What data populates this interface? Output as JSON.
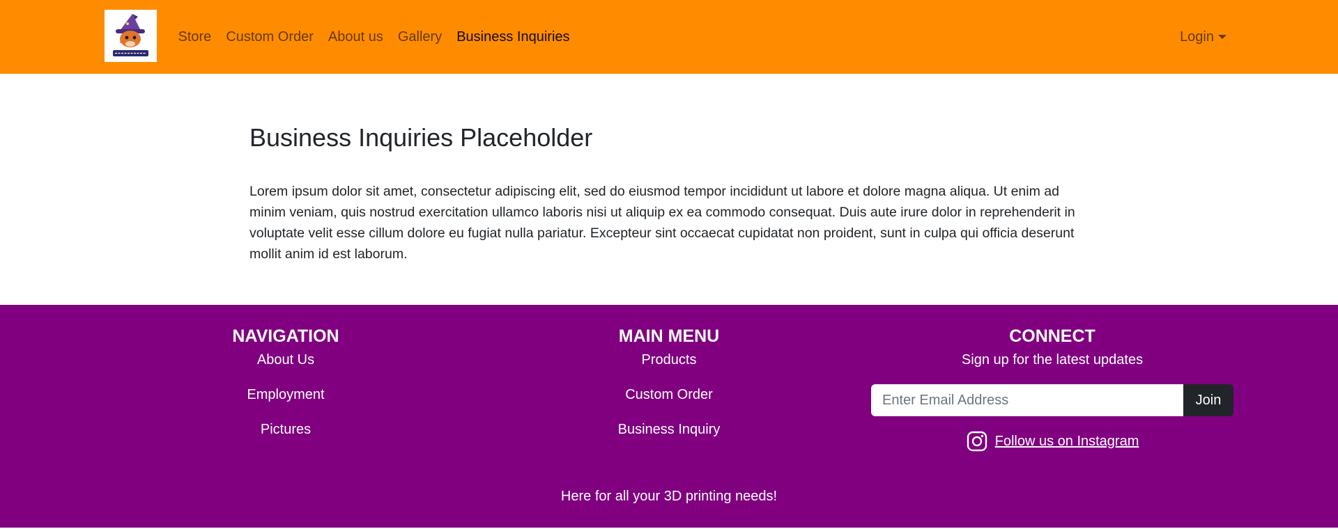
{
  "navbar": {
    "brand_alt": "3D Wizards",
    "links": [
      {
        "label": "Store"
      },
      {
        "label": "Custom Order"
      },
      {
        "label": "About us"
      },
      {
        "label": "Gallery"
      },
      {
        "label": "Business Inquiries",
        "active": true
      }
    ],
    "login_label": "Login",
    "background_color": "#ff8c00"
  },
  "main": {
    "title": "Business Inquiries Placeholder",
    "body": "Lorem ipsum dolor sit amet, consectetur adipiscing elit, sed do eiusmod tempor incididunt ut labore et dolore magna aliqua. Ut enim ad minim veniam, quis nostrud exercitation ullamco laboris nisi ut aliquip ex ea commodo consequat. Duis aute irure dolor in reprehenderit in voluptate velit esse cillum dolore eu fugiat nulla pariatur. Excepteur sint occaecat cupidatat non proident, sunt in culpa qui officia deserunt mollit anim id est laborum."
  },
  "footer": {
    "background_color": "#800080",
    "navigation": {
      "title": "NAVIGATION",
      "links": [
        {
          "label": "About Us"
        },
        {
          "label": "Employment"
        },
        {
          "label": "Pictures"
        }
      ]
    },
    "main_menu": {
      "title": "MAIN MENU",
      "links": [
        {
          "label": "Products"
        },
        {
          "label": "Custom Order"
        },
        {
          "label": "Business Inquiry"
        }
      ]
    },
    "connect": {
      "title": "CONNECT",
      "signup_text": "Sign up for the latest updates",
      "email_placeholder": "Enter Email Address",
      "email_value": "",
      "join_label": "Join",
      "instagram_icon": "instagram-icon",
      "instagram_label": "Follow us on Instagram"
    },
    "tagline": "Here for all your 3D printing needs!"
  }
}
